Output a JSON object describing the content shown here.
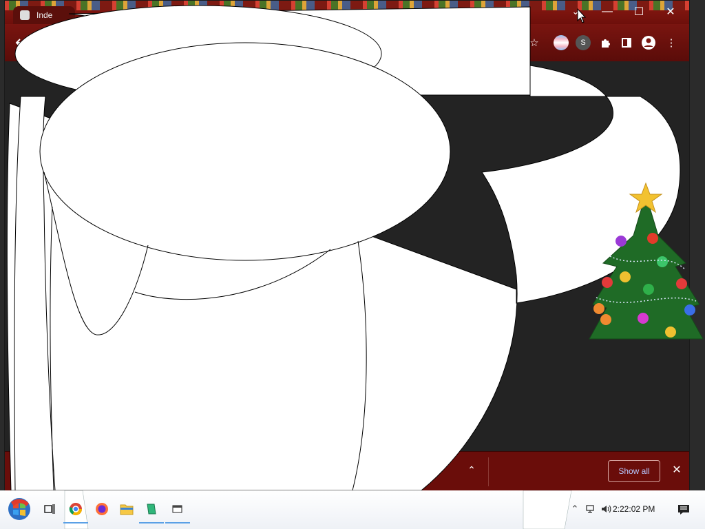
{
  "browser": {
    "tab_title": "Inde",
    "window_controls": {
      "minimize": "—",
      "maximize": "☐",
      "close": "✕"
    },
    "toolbar": {
      "back_icon": "arrow-left-icon",
      "star_icon": "star-icon",
      "extensions_icon": "puzzle-icon",
      "sidepanel_icon": "side-panel-icon",
      "profile_icon": "profile-icon",
      "menu_icon": "kebab-menu-icon",
      "extension_badge": "S"
    }
  },
  "download_bar": {
    "show_all_label": "Show all",
    "close_label": "✕",
    "chevron_label": "⌃"
  },
  "taskbar": {
    "clock": "2:22:02 PM",
    "apps": [
      "start",
      "task-view",
      "chrome",
      "firefox",
      "file-explorer",
      "app-green",
      "app-window"
    ]
  },
  "colors": {
    "title_bar": "#7a1510",
    "taskbar": "#ffffff",
    "show_all_text": "#b6c8ff"
  }
}
